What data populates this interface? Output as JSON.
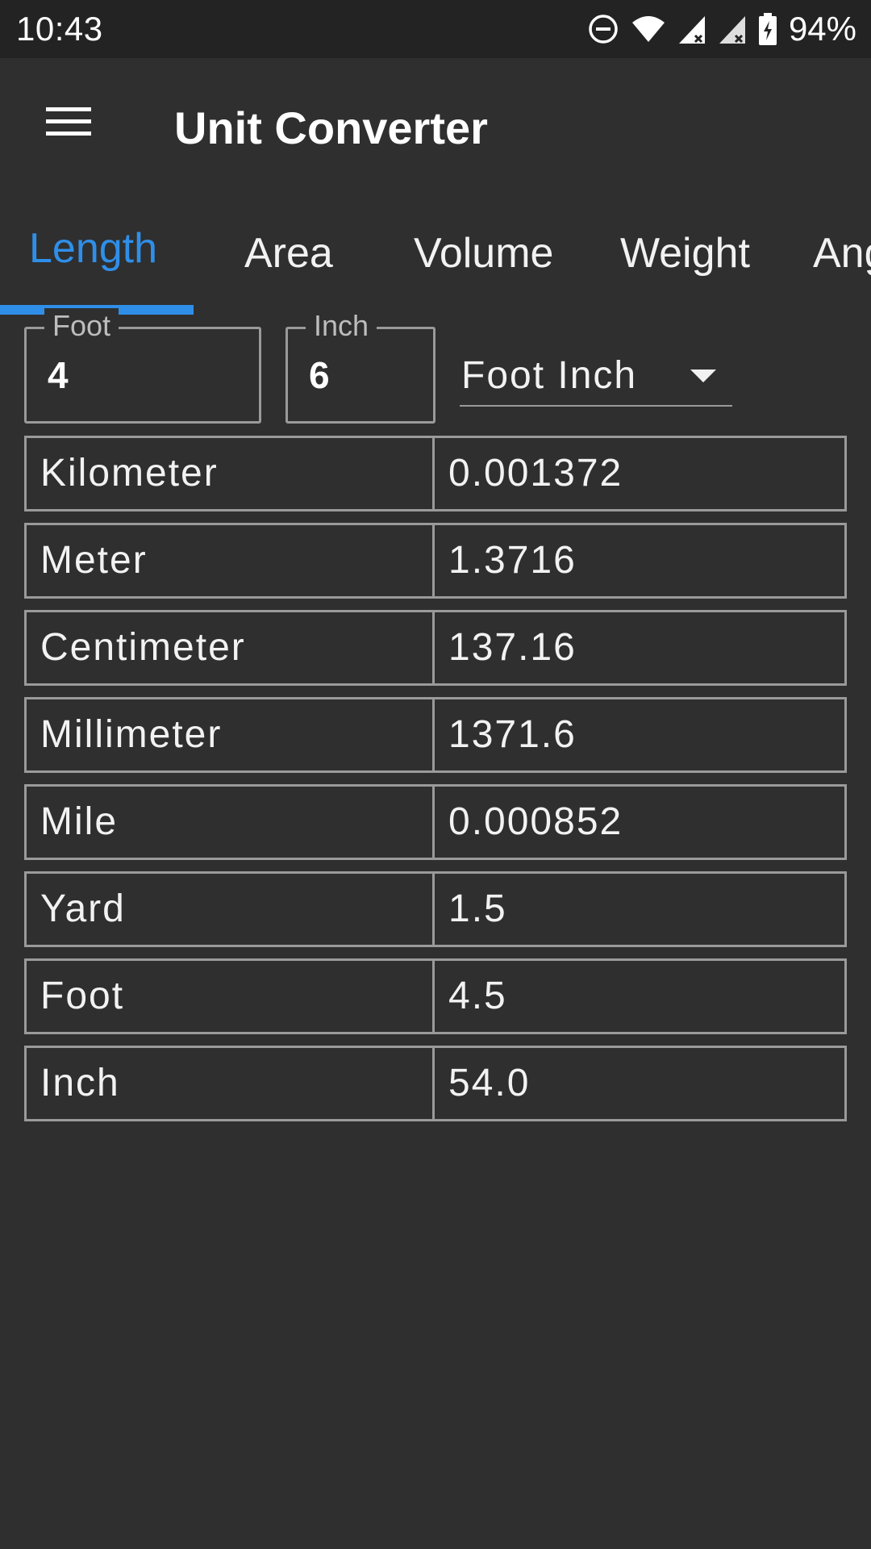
{
  "status_bar": {
    "time": "10:43",
    "battery": "94%",
    "icons": [
      "do-not-disturb-icon",
      "wifi-icon",
      "signal-icon",
      "signal-icon",
      "battery-charging-icon"
    ]
  },
  "app_bar": {
    "menu_icon": "hamburger-menu-icon",
    "title": "Unit Converter"
  },
  "tabs": [
    {
      "label": "Length",
      "active": true
    },
    {
      "label": "Area"
    },
    {
      "label": "Volume"
    },
    {
      "label": "Weight"
    },
    {
      "label": "Ang"
    }
  ],
  "inputs": {
    "foot": {
      "label": "Foot",
      "value": "4"
    },
    "inch": {
      "label": "Inch",
      "value": "6"
    },
    "unit_select": {
      "selected": "Foot Inch"
    }
  },
  "results": [
    {
      "unit": "Kilometer",
      "value": "0.001372"
    },
    {
      "unit": "Meter",
      "value": "1.3716"
    },
    {
      "unit": "Centimeter",
      "value": "137.16"
    },
    {
      "unit": "Millimeter",
      "value": "1371.6"
    },
    {
      "unit": "Mile",
      "value": "0.000852"
    },
    {
      "unit": "Yard",
      "value": "1.5"
    },
    {
      "unit": "Foot",
      "value": "4.5"
    },
    {
      "unit": "Inch",
      "value": "54.0"
    }
  ],
  "colors": {
    "background": "#2f2f30",
    "status_bar": "#232323",
    "accent": "#2f8fe8",
    "border": "#9a9a9a",
    "text": "#f2f2f2"
  }
}
